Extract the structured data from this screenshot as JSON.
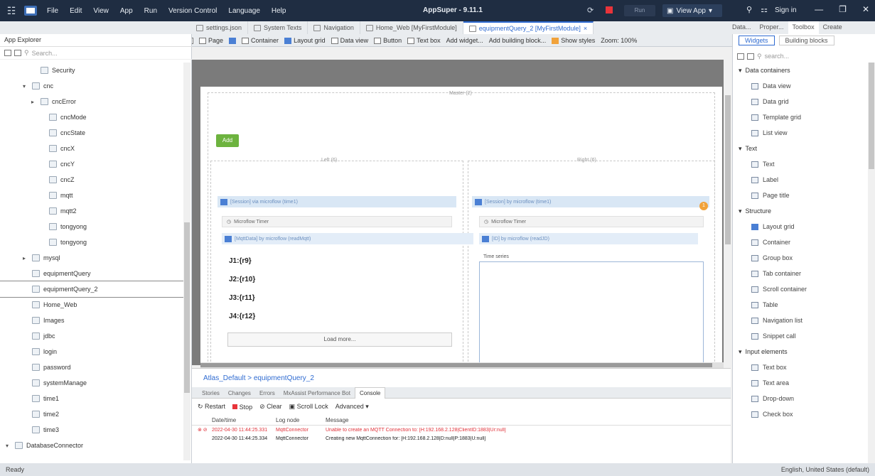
{
  "titlebar": {
    "menu": [
      "File",
      "Edit",
      "View",
      "App",
      "Run",
      "Version Control",
      "Language",
      "Help"
    ],
    "title": "AppSuper - 9.11.1",
    "run_label": "Run",
    "view_app_label": "View App",
    "signin_label": "Sign in"
  },
  "doc_tabs": [
    {
      "label": "settings.json",
      "active": false
    },
    {
      "label": "System Texts",
      "active": false
    },
    {
      "label": "Navigation",
      "active": false
    },
    {
      "label": "Home_Web [MyFirstModule]",
      "active": false
    },
    {
      "label": "equipmentQuery_2 [MyFirstModule]",
      "active": true
    }
  ],
  "right_tabs": [
    "Data...",
    "Proper...",
    "Toolbox",
    "Create"
  ],
  "left_pane": {
    "title": "App Explorer",
    "search_placeholder": "Search...",
    "tree": [
      {
        "label": "Security",
        "indent": 3,
        "arrow": ""
      },
      {
        "label": "cnc",
        "indent": 2,
        "arrow": "v"
      },
      {
        "label": "cncError",
        "indent": 3,
        "arrow": ">"
      },
      {
        "label": "cncMode",
        "indent": 4,
        "arrow": ""
      },
      {
        "label": "cncState",
        "indent": 4,
        "arrow": ""
      },
      {
        "label": "cncX",
        "indent": 4,
        "arrow": ""
      },
      {
        "label": "cncY",
        "indent": 4,
        "arrow": ""
      },
      {
        "label": "cncZ",
        "indent": 4,
        "arrow": ""
      },
      {
        "label": "mqtt",
        "indent": 4,
        "arrow": ""
      },
      {
        "label": "mqtt2",
        "indent": 4,
        "arrow": ""
      },
      {
        "label": "tongyong",
        "indent": 4,
        "arrow": ""
      },
      {
        "label": "tongyong",
        "indent": 4,
        "arrow": ""
      },
      {
        "label": "mysql",
        "indent": 2,
        "arrow": ">"
      },
      {
        "label": "equipmentQuery",
        "indent": 2,
        "arrow": ""
      },
      {
        "label": "equipmentQuery_2",
        "indent": 2,
        "arrow": "",
        "selected": true
      },
      {
        "label": "Home_Web",
        "indent": 2,
        "arrow": ""
      },
      {
        "label": "Images",
        "indent": 2,
        "arrow": ""
      },
      {
        "label": "jdbc",
        "indent": 2,
        "arrow": ""
      },
      {
        "label": "login",
        "indent": 2,
        "arrow": ""
      },
      {
        "label": "password",
        "indent": 2,
        "arrow": ""
      },
      {
        "label": "systemManage",
        "indent": 2,
        "arrow": ""
      },
      {
        "label": "time1",
        "indent": 2,
        "arrow": ""
      },
      {
        "label": "time2",
        "indent": 2,
        "arrow": ""
      },
      {
        "label": "time3",
        "indent": 2,
        "arrow": ""
      },
      {
        "label": "DatabaseConnector",
        "indent": 0,
        "arrow": "v"
      }
    ]
  },
  "editor_toolbar": {
    "page": "Page",
    "container": "Container",
    "layout_grid": "Layout grid",
    "data_view": "Data view",
    "button": "Button",
    "text_box": "Text box",
    "add_widget": "Add widget...",
    "add_block": "Add building block...",
    "show_styles": "Show styles",
    "zoom": "Zoom: 100%"
  },
  "canvas": {
    "layout_label": "Master (2)",
    "add_button": "Add",
    "col_left": "Left (6)",
    "col_right": "Right (6)",
    "dv_left": "[Session] via microflow (time1)",
    "dv_right": "[Session] by microflow (time1)",
    "timer_left": "Microflow Timer",
    "timer_right": "Microflow Timer",
    "lv_left": "[MqttData] by microflow (readMqtt)",
    "lv_right": "[ID] by microflow (readJD)",
    "list_items": [
      "J1:{r9}",
      "J2:{r10}",
      "J3:{r11}",
      "J4:{r12}"
    ],
    "load_more": "Load more...",
    "time_series": "Time series",
    "badge": "1"
  },
  "bottom": {
    "breadcrumb": "Atlas_Default > equipmentQuery_2",
    "tabs": [
      "Stories",
      "Changes",
      "Errors",
      "MxAssist Performance Bot",
      "Console"
    ],
    "toolbar": {
      "restart": "Restart",
      "stop": "Stop",
      "clear": "Clear",
      "scroll_lock": "Scroll Lock",
      "advanced": "Advanced"
    },
    "columns": [
      "Date/time",
      "Log node",
      "Message"
    ],
    "rows": [
      {
        "date": "2022-04-30 11:44:25.331",
        "node": "MqttConnector",
        "msg": "Unable to create an MQTT Connection to: [H:192.168.2.128|ClientID:1883|Ur:null]",
        "error": true
      },
      {
        "date": "2022-04-30 11:44:25.334",
        "node": "MqttConnector",
        "msg": "Creating new MqttConnection for: [H:192.168.2.128|D:null|P:1883|U:null]",
        "error": false
      }
    ]
  },
  "right_pane": {
    "tabs": [
      "Widgets",
      "Building blocks"
    ],
    "search_placeholder": "search...",
    "sections": [
      {
        "label": "Data containers",
        "items": [
          "Data view",
          "Data grid",
          "Template grid",
          "List view"
        ]
      },
      {
        "label": "Text",
        "items": [
          "Text",
          "Label",
          "Page title"
        ]
      },
      {
        "label": "Structure",
        "items": [
          "Layout grid",
          "Container",
          "Group box",
          "Tab container",
          "Scroll container",
          "Table",
          "Navigation list",
          "Snippet call"
        ]
      },
      {
        "label": "Input elements",
        "items": [
          "Text box",
          "Text area",
          "Drop-down",
          "Check box"
        ]
      }
    ]
  },
  "statusbar": {
    "left": "Ready",
    "right": "English, United States (default)"
  }
}
